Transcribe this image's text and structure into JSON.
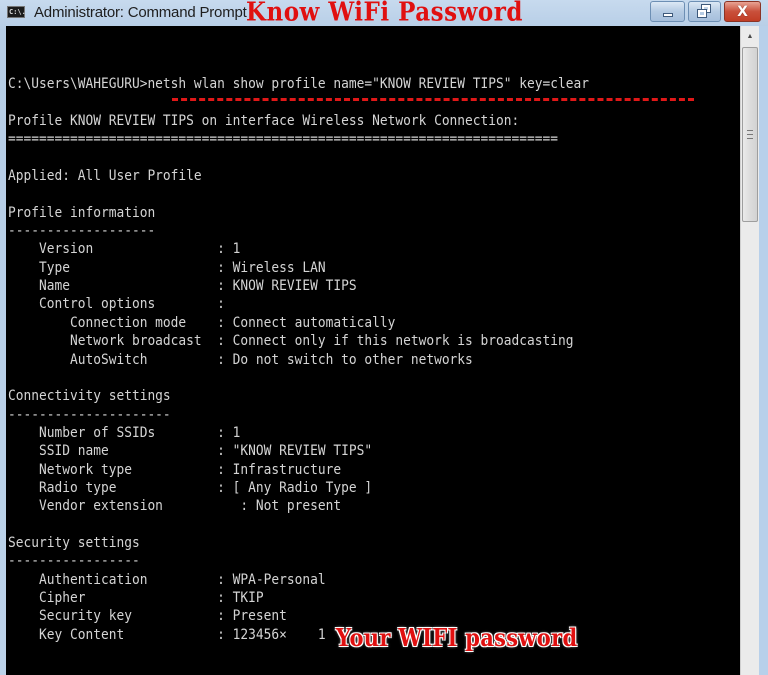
{
  "window": {
    "title": "Administrator: Command Prompt",
    "app_icon": "command-prompt-icon",
    "app_icon_text": "C:\\.",
    "controls": {
      "minimize_icon": "minimize-icon",
      "maximize_icon": "restore-icon",
      "close_glyph": "X"
    }
  },
  "annotations": {
    "title_overlay": "Know WiFi Password",
    "password_overlay": "Your WIFI password",
    "accent_color": "#e01010"
  },
  "console": {
    "lines": [
      "",
      "C:\\Users\\WAHEGURU>netsh wlan show profile name=\"KNOW REVIEW TIPS\" key=clear",
      "",
      "Profile KNOW REVIEW TIPS on interface Wireless Network Connection:",
      "=======================================================================",
      "",
      "Applied: All User Profile",
      "",
      "Profile information",
      "-------------------",
      "    Version                : 1",
      "    Type                   : Wireless LAN",
      "    Name                   : KNOW REVIEW TIPS",
      "    Control options        :",
      "        Connection mode    : Connect automatically",
      "        Network broadcast  : Connect only if this network is broadcasting",
      "        AutoSwitch         : Do not switch to other networks",
      "",
      "Connectivity settings",
      "---------------------",
      "    Number of SSIDs        : 1",
      "    SSID name              : \"KNOW REVIEW TIPS\"",
      "    Network type           : Infrastructure",
      "    Radio type             : [ Any Radio Type ]",
      "    Vendor extension          : Not present",
      "",
      "Security settings",
      "-----------------",
      "    Authentication         : WPA-Personal",
      "    Cipher                 : TKIP",
      "    Security key           : Present",
      "    Key Content            : 123456×    1"
    ]
  },
  "scrollbar": {
    "up_arrow": "▲",
    "position_fraction": 0.0
  }
}
